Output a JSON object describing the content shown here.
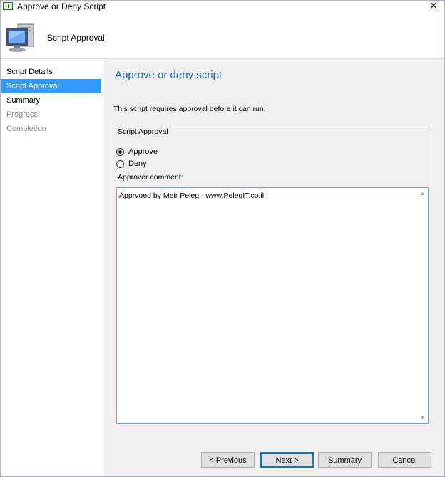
{
  "window": {
    "title": "Approve or Deny Script",
    "close_icon": "close-icon"
  },
  "header": {
    "title": "Script Approval",
    "icon": "computer-monitor-icon"
  },
  "nav": {
    "items": [
      {
        "label": "Script Details",
        "state": "normal"
      },
      {
        "label": "Script Approval",
        "state": "active"
      },
      {
        "label": "Summary",
        "state": "normal"
      },
      {
        "label": "Progress",
        "state": "disabled"
      },
      {
        "label": "Completion",
        "state": "disabled"
      }
    ]
  },
  "content": {
    "title": "Approve or deny script",
    "message": "This script requires approval before it can run.",
    "group_label": "Script Approval",
    "options": [
      {
        "label": "Approve",
        "checked": true
      },
      {
        "label": "Deny",
        "checked": false
      }
    ],
    "comment_label": "Approver comment:",
    "comment_value": "Apprvoed by Meir Peleg - www.PelegIT.co.il"
  },
  "footer": {
    "previous": "< Previous",
    "next": "Next >",
    "summary": "Summary",
    "cancel": "Cancel"
  },
  "colors": {
    "accent": "#3399ff",
    "title_blue": "#1f5fa6",
    "panel_bg": "#f0f0f0"
  }
}
